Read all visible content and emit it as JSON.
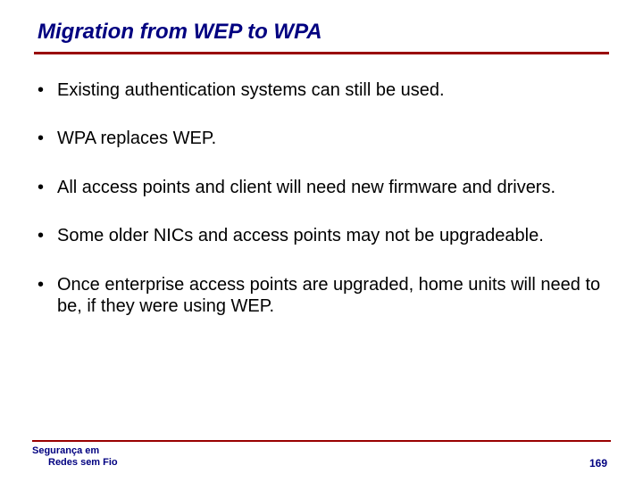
{
  "title": "Migration from WEP to WPA",
  "bullets": [
    "Existing authentication systems can still be used.",
    "WPA replaces WEP.",
    "All access points and client will need new firmware and drivers.",
    "Some older NICs and access points may not be upgradeable.",
    "Once enterprise access points are upgraded, home units will need to be, if they were using WEP."
  ],
  "footer": {
    "line1": "Segurança em",
    "line2": "Redes sem Fio",
    "page": "169"
  }
}
